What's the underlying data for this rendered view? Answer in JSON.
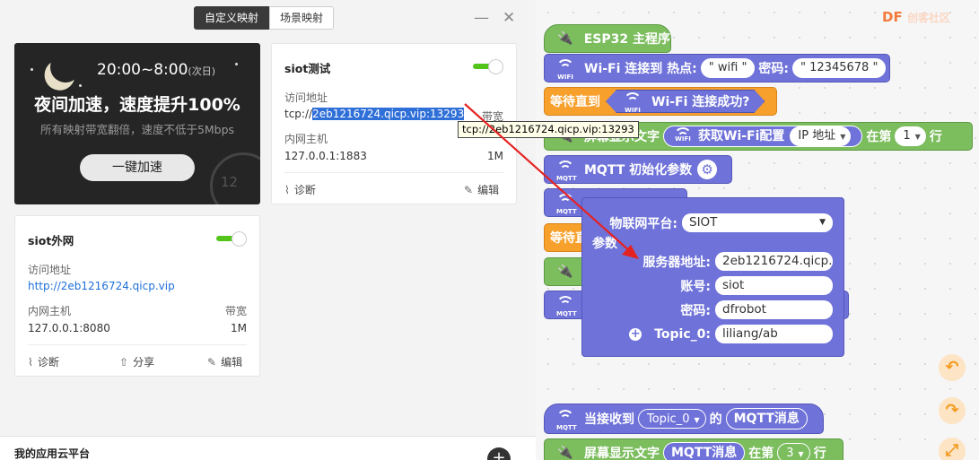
{
  "tabs": [
    "自定义映射",
    "场景映射"
  ],
  "window": {
    "minimize": "—",
    "close": "✕"
  },
  "promo": {
    "time": "20:00~8:00",
    "time_suffix": "(次日)",
    "title": "夜间加速，速度提升100%",
    "subtitle": "所有映射带宽翻倍，速度不低于5Mbps",
    "button": "一键加速",
    "gauge_number": "12"
  },
  "card_siot_test": {
    "name": "siot测试",
    "enabled": true,
    "address_label": "访问地址",
    "address_prefix": "tcp://",
    "address_selected": "2eb1216724.qicp.vip:13293",
    "bandwidth_label": "带宽",
    "host_label": "内网主机",
    "host": "127.0.0.1:1883",
    "bandwidth": "1M",
    "diagnose": "诊断",
    "edit": "编辑",
    "tooltip": "tcp://2eb1216724.qicp.vip:13293"
  },
  "card_siot_ext": {
    "name": "siot外网",
    "enabled": true,
    "address_label": "访问地址",
    "address": "http://2eb1216724.qicp.vip",
    "host_label": "内网主机",
    "host": "127.0.0.1:8080",
    "bandwidth_label": "带宽",
    "bandwidth": "1M",
    "diagnose": "诊断",
    "share": "分享",
    "edit": "编辑"
  },
  "bottom": {
    "title": "我的应用云平台",
    "add": "+"
  },
  "logo": {
    "text": "DF",
    "suffix": "创客社区"
  },
  "blocks": {
    "esp32_main": "ESP32 主程序",
    "wifi_connect": "Wi-Fi 连接到 热点:",
    "wifi_ssid": "\" wifi \"",
    "password_label": "密码:",
    "wifi_password": "\" 12345678 \"",
    "wait_until": "等待直到",
    "wifi_connected": "Wi-Fi 连接成功?",
    "screen_show": "屏幕显示文字",
    "get_wifi_config": "获取Wi-Fi配置",
    "ip_address": "IP 地址",
    "at_line": "在第",
    "line_num": "1",
    "line": "行",
    "mqtt_init": "MQTT 初始化参数",
    "wait_partial": "等待直",
    "on_receive": "当接收到",
    "topic": "Topic_0",
    "of": "的",
    "mqtt_message": "MQTT消息",
    "screen_show2": "屏幕显示文字",
    "mqtt_message2": "MQTT消息",
    "at_line2": "在第",
    "line_num2": "3",
    "line2": "行",
    "wifi_small": "WIFI",
    "mqtt_small": "MQTT"
  },
  "popup": {
    "platform_label": "物联网平台:",
    "platform": "SIOT",
    "params_label": "参数",
    "server_label": "服务器地址:",
    "server": "2eb1216724.qicp.",
    "account_label": "账号:",
    "account": "siot",
    "password_label": "密码:",
    "password": "dfrobot",
    "topic_label": "Topic_0:",
    "topic": "liliang/ab",
    "add": "+"
  },
  "side_buttons": [
    "↶",
    "↷",
    "⤢"
  ]
}
